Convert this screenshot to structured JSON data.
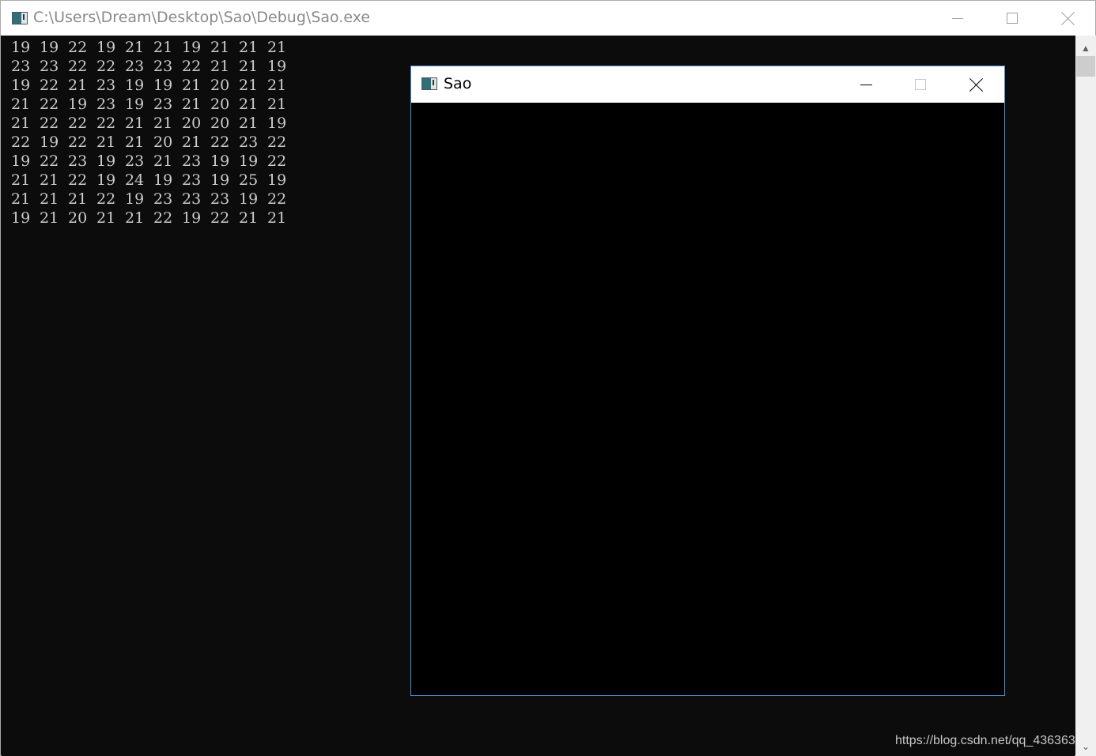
{
  "console": {
    "title": "C:\\Users\\Dream\\Desktop\\Sao\\Debug\\Sao.exe",
    "icon": "console-app-icon",
    "rows": [
      [
        "19",
        "19",
        "22",
        "19",
        "21",
        "21",
        "19",
        "21",
        "21",
        "21"
      ],
      [
        "23",
        "23",
        "22",
        "22",
        "23",
        "23",
        "22",
        "21",
        "21",
        "19"
      ],
      [
        "19",
        "22",
        "21",
        "23",
        "19",
        "19",
        "21",
        "20",
        "21",
        "21"
      ],
      [
        "21",
        "22",
        "19",
        "23",
        "19",
        "23",
        "21",
        "20",
        "21",
        "21"
      ],
      [
        "21",
        "22",
        "22",
        "22",
        "21",
        "21",
        "20",
        "20",
        "21",
        "19"
      ],
      [
        "22",
        "19",
        "22",
        "21",
        "21",
        "20",
        "21",
        "22",
        "23",
        "22"
      ],
      [
        "19",
        "22",
        "23",
        "19",
        "23",
        "21",
        "23",
        "19",
        "19",
        "22"
      ],
      [
        "21",
        "21",
        "22",
        "19",
        "24",
        "19",
        "23",
        "19",
        "25",
        "19"
      ],
      [
        "21",
        "21",
        "21",
        "22",
        "19",
        "23",
        "23",
        "23",
        "19",
        "22"
      ],
      [
        "19",
        "21",
        "20",
        "21",
        "21",
        "22",
        "19",
        "22",
        "21",
        "21"
      ]
    ],
    "background_color": "#0c0c0c",
    "text_color": "#cccccc"
  },
  "sao_window": {
    "title": "Sao",
    "icon": "app-icon",
    "border_color": "#4a8fd1",
    "client_color": "#000000"
  },
  "watermark": "https://blog.csdn.net/qq_436363"
}
